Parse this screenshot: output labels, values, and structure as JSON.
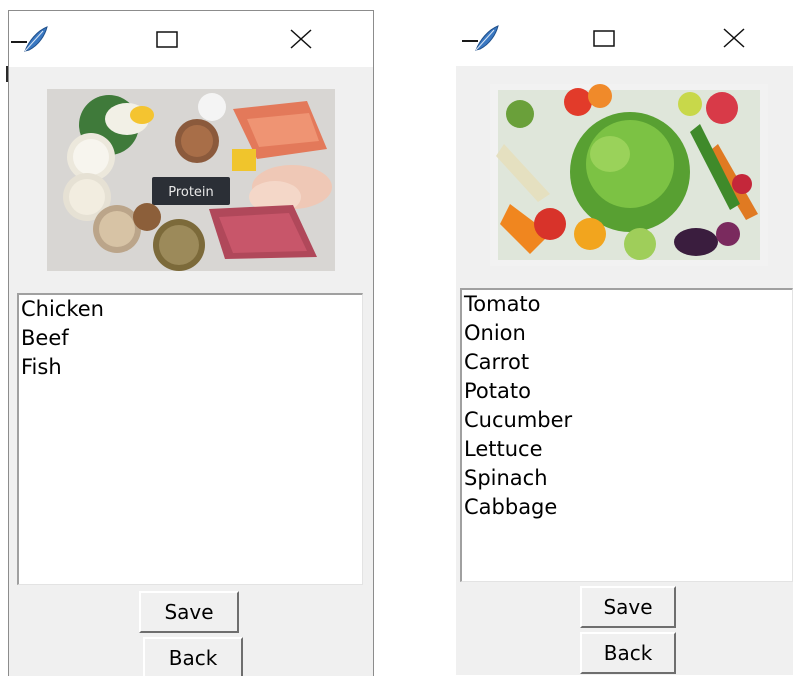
{
  "windows": [
    {
      "id": "protein",
      "titlebar": {
        "icon": "feather-icon",
        "maximize_icon": "maximize-icon",
        "close_icon": "close-icon"
      },
      "image": {
        "description_icon": "protein-foods-image"
      },
      "list": {
        "items": [
          "Chicken",
          "Beef",
          "Fish"
        ]
      },
      "buttons": {
        "save_label": "Save",
        "back_label": "Back"
      }
    },
    {
      "id": "vegetables",
      "titlebar": {
        "icon": "feather-icon",
        "maximize_icon": "maximize-icon",
        "close_icon": "close-icon"
      },
      "image": {
        "description_icon": "vegetables-image"
      },
      "list": {
        "items": [
          "Tomato",
          "Onion",
          "Carrot",
          "Potato",
          "Cucumber",
          "Lettuce",
          "Spinach",
          "Cabbage"
        ]
      },
      "buttons": {
        "save_label": "Save",
        "back_label": "Back"
      }
    }
  ],
  "colors": {
    "window_bg": "#f0f0f0",
    "titlebar_bg": "#ffffff",
    "list_bg": "#ffffff",
    "feather": "#2f6fbf"
  }
}
